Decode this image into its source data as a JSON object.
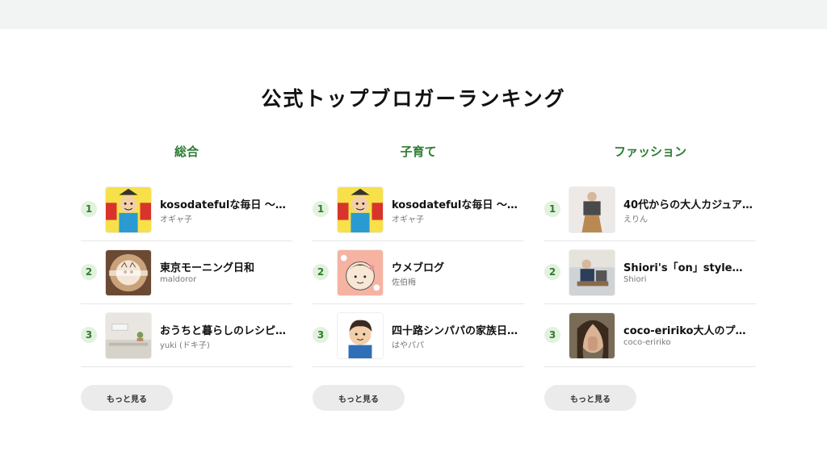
{
  "page_title": "公式トップブロガーランキング",
  "columns": [
    {
      "heading": "総合",
      "items": [
        {
          "rank": "1",
          "name": "kosodatefulな毎日 〜…",
          "author": "オギャ子"
        },
        {
          "rank": "2",
          "name": "東京モーニング日和",
          "author": "maldoror"
        },
        {
          "rank": "3",
          "name": "おうちと暮らしのレシピ…",
          "author": "yuki (ドキ子)"
        }
      ],
      "more_label": "もっと見る"
    },
    {
      "heading": "子育て",
      "items": [
        {
          "rank": "1",
          "name": "kosodatefulな毎日 〜…",
          "author": "オギャ子"
        },
        {
          "rank": "2",
          "name": "ウメブログ",
          "author": "佐伯梅"
        },
        {
          "rank": "3",
          "name": "四十路シンパパの家族日…",
          "author": "はやパパ"
        }
      ],
      "more_label": "もっと見る"
    },
    {
      "heading": "ファッション",
      "items": [
        {
          "rank": "1",
          "name": "40代からの大人カジュア…",
          "author": "えりん"
        },
        {
          "rank": "2",
          "name": "Shiori's「on」style〜…",
          "author": "Shiori"
        },
        {
          "rank": "3",
          "name": "coco-eririko大人のプチ…",
          "author": "coco-eririko"
        }
      ],
      "more_label": "もっと見る"
    }
  ],
  "colors": {
    "accent": "#2e7d32",
    "rank_badge_bg": "#e3f2de",
    "button_bg": "#ebebeb",
    "topbar_bg": "#f2f3f3"
  }
}
